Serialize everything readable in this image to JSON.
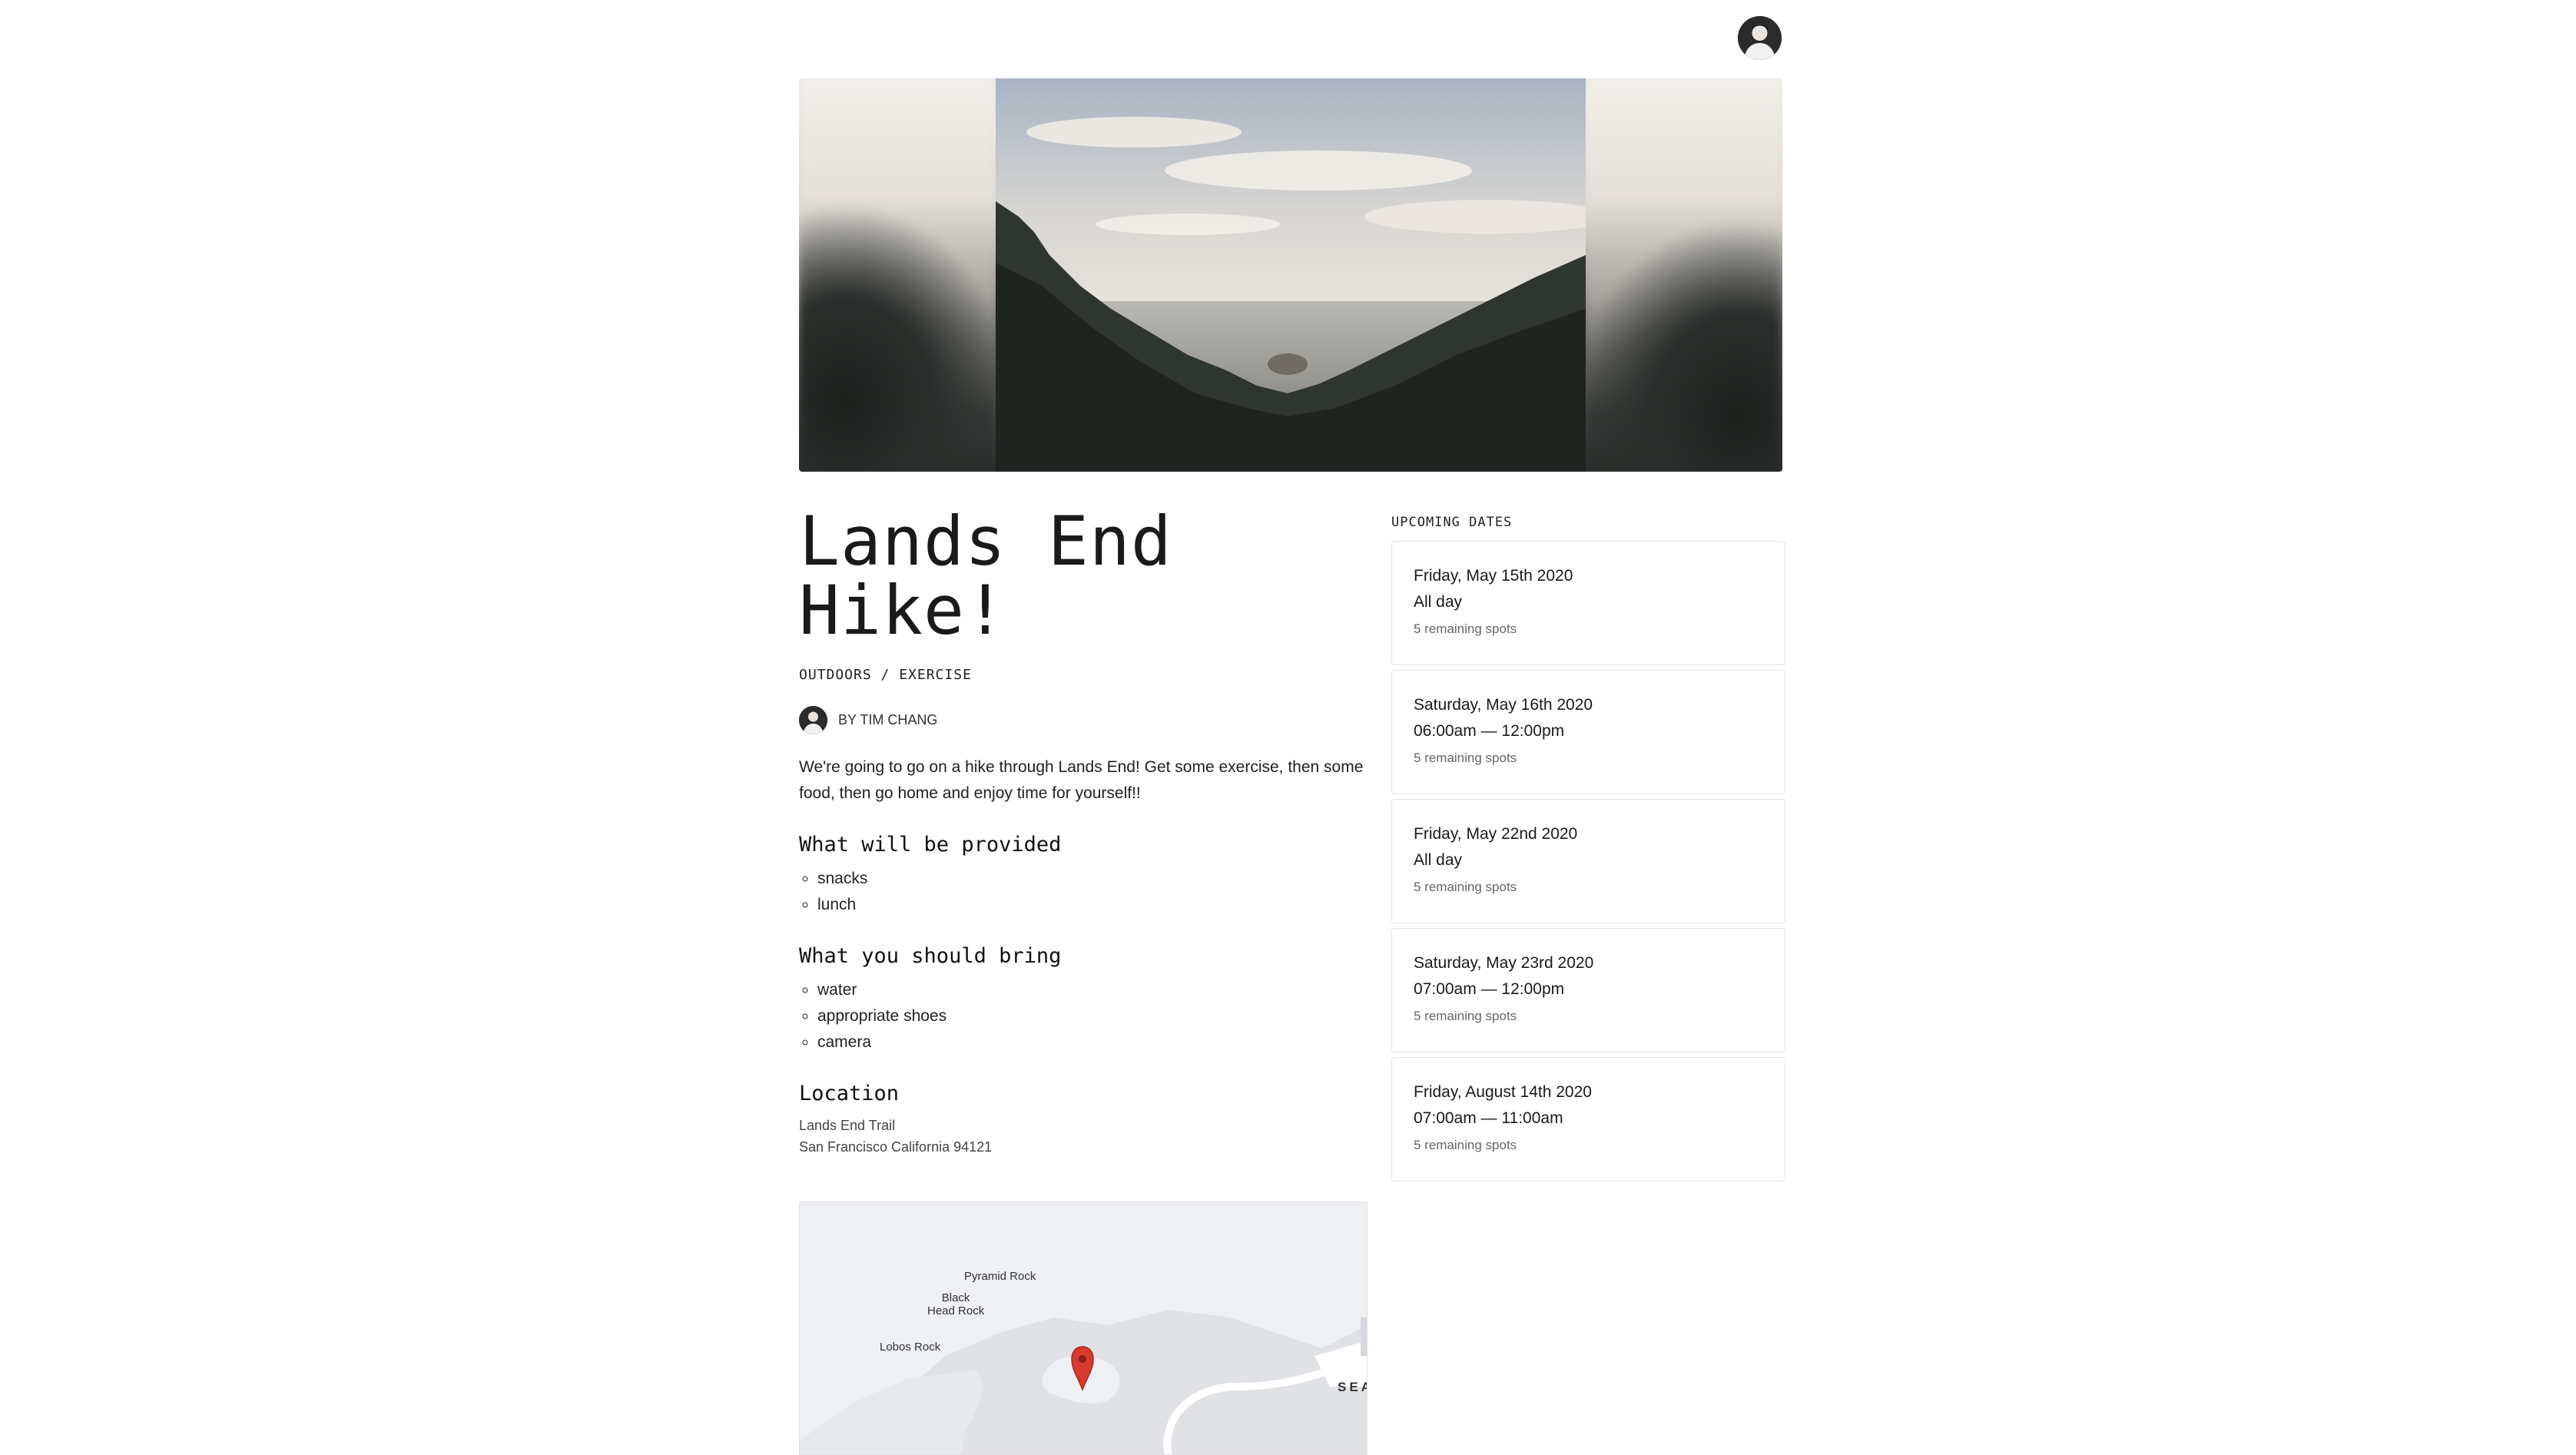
{
  "event": {
    "title_line1": "Lands End",
    "title_line2": "Hike!",
    "category": "OUTDOORS / EXERCISE",
    "byline": "BY TIM CHANG",
    "description": "We're going to go on a hike through Lands End! Get some exercise, then some food, then go home and enjoy time for yourself!!"
  },
  "provided": {
    "heading": "What will be provided",
    "items": [
      "snacks",
      "lunch"
    ]
  },
  "bring": {
    "heading": "What you should bring",
    "items": [
      "water",
      "appropriate shoes",
      "camera"
    ]
  },
  "location": {
    "heading": "Location",
    "line1": "Lands End Trail",
    "line2": "San Francisco California 94121"
  },
  "map": {
    "labels": {
      "pyramid_rock": "Pyramid Rock",
      "black_head_line1": "Black",
      "black_head_line2": "Head Rock",
      "lobos_rock": "Lobos Rock",
      "sea": "SEA"
    },
    "marker_color": "#d93a2e"
  },
  "upcoming": {
    "heading": "UPCOMING DATES",
    "dates": [
      {
        "date": "Friday, May 15th 2020",
        "time": "All day",
        "spots": "5 remaining spots"
      },
      {
        "date": "Saturday, May 16th 2020",
        "time": "06:00am — 12:00pm",
        "spots": "5 remaining spots"
      },
      {
        "date": "Friday, May 22nd 2020",
        "time": "All day",
        "spots": "5 remaining spots"
      },
      {
        "date": "Saturday, May 23rd 2020",
        "time": "07:00am — 12:00pm",
        "spots": "5 remaining spots"
      },
      {
        "date": "Friday, August 14th 2020",
        "time": "07:00am — 11:00am",
        "spots": "5 remaining spots"
      }
    ]
  }
}
